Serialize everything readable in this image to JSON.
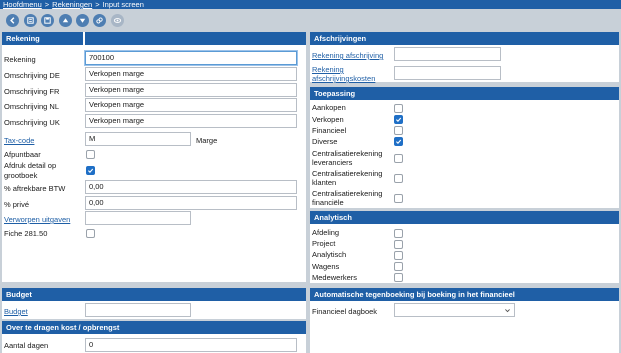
{
  "breadcrumb": {
    "home": "Hoofdmenu",
    "accounts": "Rekeningen",
    "current": "Input screen",
    "sep": ">"
  },
  "toolbar": {
    "icons": [
      "back-icon",
      "list-icon",
      "save-icon",
      "up-icon",
      "down-icon",
      "link-icon",
      "preview-icon"
    ]
  },
  "rekening": {
    "header": "Rekening",
    "fields": {
      "rekening": {
        "label": "Rekening",
        "value": "700100"
      },
      "omschrijving_de": {
        "label": "Omschrijving DE",
        "value": "Verkopen marge"
      },
      "omschrijving_fr": {
        "label": "Omschrijving FR",
        "value": "Verkopen marge"
      },
      "omschrijving_nl": {
        "label": "Omschrijving NL",
        "value": "Verkopen marge"
      },
      "omschrijving_uk": {
        "label": "Omschrijving UK",
        "value": "Verkopen marge"
      },
      "tax_code": {
        "label": "Tax-code",
        "value": "M",
        "suffix": "Marge"
      },
      "afpuntbaar": {
        "label": "Afpuntbaar",
        "checked": false
      },
      "afdruk_detail": {
        "label_1": "Afdruk detail op",
        "label_2": "grootboek",
        "checked": true
      },
      "aftrekbare_btw": {
        "label": "% aftrekbare BTW",
        "value": "0,00"
      },
      "prive": {
        "label": "% privé",
        "value": "0,00"
      },
      "verworpen_uitgaven": {
        "label": "Verworpen uitgaven",
        "value": ""
      },
      "fiche": {
        "label": "Fiche 281.50",
        "checked": false
      }
    }
  },
  "afschrijvingen": {
    "header": "Afschrijvingen",
    "rekening_afschrijving": {
      "label": "Rekening afschrijving",
      "value": ""
    },
    "rekening_kosten": {
      "label_1": "Rekening",
      "label_2": "afschrijvingskosten",
      "value": ""
    }
  },
  "toepassing": {
    "header": "Toepassing",
    "items": [
      {
        "label_1": "Aankopen",
        "label_2": "",
        "checked": false
      },
      {
        "label_1": "Verkopen",
        "label_2": "",
        "checked": true
      },
      {
        "label_1": "Financieel",
        "label_2": "",
        "checked": false
      },
      {
        "label_1": "Diverse",
        "label_2": "",
        "checked": true
      },
      {
        "label_1": "Centralisatierekening",
        "label_2": "leveranciers",
        "checked": false
      },
      {
        "label_1": "Centralisatierekening",
        "label_2": "klanten",
        "checked": false
      },
      {
        "label_1": "Centralisatierekening",
        "label_2": "financiële",
        "checked": false
      }
    ]
  },
  "analytisch": {
    "header": "Analytisch",
    "items": [
      {
        "label": "Afdeling",
        "checked": false
      },
      {
        "label": "Project",
        "checked": false
      },
      {
        "label": "Analytisch",
        "checked": false
      },
      {
        "label": "Wagens",
        "checked": false
      },
      {
        "label": "Medewerkers",
        "checked": false
      }
    ]
  },
  "budget": {
    "header": "Budget",
    "label": "Budget",
    "value": ""
  },
  "over_te_dragen": {
    "header": "Over te dragen kost / opbrengst",
    "label": "Aantal dagen",
    "value": "0"
  },
  "tegenboeking": {
    "header": "Automatische tegenboeking bij boeking in het financieel",
    "label": "Financieel dagboek",
    "value": ""
  },
  "colors": {
    "header_bg": "#1f5fa6",
    "link": "#1f5fa6",
    "check": "#1f6fc6"
  }
}
